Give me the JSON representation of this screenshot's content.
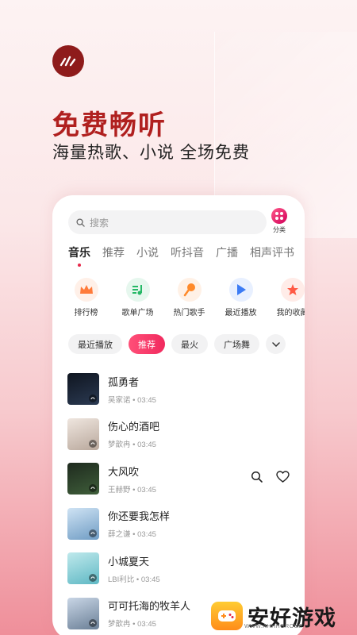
{
  "hero": {
    "title": "免费畅听",
    "subtitle": "海量热歌、小说 全场免费"
  },
  "search": {
    "placeholder": "搜索",
    "category_label": "分类"
  },
  "tabs": [
    {
      "label": "音乐",
      "active": true
    },
    {
      "label": "推荐",
      "active": false
    },
    {
      "label": "小说",
      "active": false
    },
    {
      "label": "听抖音",
      "active": false
    },
    {
      "label": "广播",
      "active": false
    },
    {
      "label": "相声评书",
      "active": false
    }
  ],
  "shortcuts": [
    {
      "label": "排行榜",
      "icon": "crown-icon",
      "color": "#ff7b3a"
    },
    {
      "label": "歌单广场",
      "icon": "playlist-icon",
      "color": "#25b866"
    },
    {
      "label": "热门歌手",
      "icon": "microphone-icon",
      "color": "#ff8a2a"
    },
    {
      "label": "最近播放",
      "icon": "play-icon",
      "color": "#3c7cf5"
    },
    {
      "label": "我的收藏",
      "icon": "star-icon",
      "color": "#ff5a45"
    }
  ],
  "chips": [
    {
      "label": "最近播放",
      "active": false
    },
    {
      "label": "推荐",
      "active": true
    },
    {
      "label": "最火",
      "active": false
    },
    {
      "label": "广场舞",
      "active": false
    }
  ],
  "songs": [
    {
      "title": "孤勇者",
      "artist": "吴家诺",
      "duration": "03:45",
      "cover_color": "#1c2433"
    },
    {
      "title": "伤心的酒吧",
      "artist": "梦歆冉",
      "duration": "03:45",
      "cover_color": "#d9cfc8"
    },
    {
      "title": "大风吹",
      "artist": "王赫野",
      "duration": "03:45",
      "cover_color": "#2a3a2a",
      "show_actions": true
    },
    {
      "title": "你还要我怎样",
      "artist": "薛之谦",
      "duration": "03:45",
      "cover_color": "#9fc3e0"
    },
    {
      "title": "小城夏天",
      "artist": "LBI利比",
      "duration": "03:45",
      "cover_color": "#8fd0d8"
    },
    {
      "title": "可可托海的牧羊人",
      "artist": "梦歆冉",
      "duration": "03:45",
      "cover_color": "#8aa0bb"
    }
  ],
  "watermark": {
    "text": "安好游戏",
    "small": "WWW.AHHHGROUP"
  },
  "colors": {
    "accent": "#e6284a",
    "hero_title": "#b0201f",
    "logo_bg": "#8e1b1b"
  }
}
